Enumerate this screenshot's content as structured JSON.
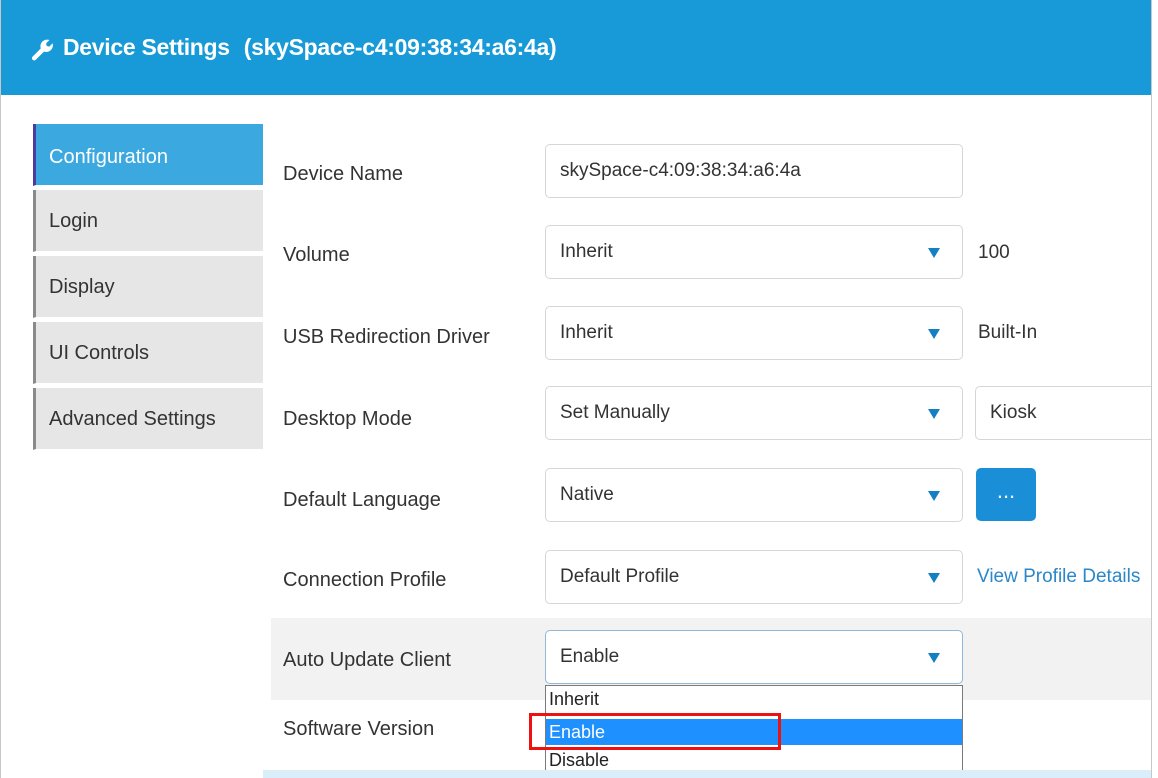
{
  "header": {
    "title": "Device Settings",
    "subtitle": "(skySpace-c4:09:38:34:a6:4a)",
    "icon": "wrench-icon",
    "color": "#179ad7"
  },
  "tabs": [
    {
      "label": "Configuration",
      "active": true
    },
    {
      "label": "Login",
      "active": false
    },
    {
      "label": "Display",
      "active": false
    },
    {
      "label": "UI Controls",
      "active": false
    },
    {
      "label": "Advanced Settings",
      "active": false
    }
  ],
  "form": {
    "device_name": {
      "label": "Device Name",
      "value": "skySpace-c4:09:38:34:a6:4a"
    },
    "volume": {
      "label": "Volume",
      "value": "Inherit",
      "extra": "100"
    },
    "usb_redirection": {
      "label": "USB Redirection Driver",
      "value": "Inherit",
      "extra": "Built-In"
    },
    "desktop_mode": {
      "label": "Desktop Mode",
      "value": "Set Manually",
      "extra": "Kiosk"
    },
    "default_language": {
      "label": "Default Language",
      "value": "Native",
      "button": "..."
    },
    "connection_profile": {
      "label": "Connection Profile",
      "value": "Default Profile",
      "link": "View Profile Details"
    },
    "auto_update": {
      "label": "Auto Update Client",
      "value": "Enable",
      "options": [
        "Inherit",
        "Enable",
        "Disable"
      ],
      "selected_option": "Enable"
    },
    "software_version": {
      "label": "Software Version"
    }
  },
  "colors": {
    "accent": "#179ad7",
    "active_tab": "#3ba9e0",
    "caret": "#1480c4",
    "selected_option": "#1e90ff",
    "highlight": "#ee1111",
    "link": "#2a87c9"
  }
}
